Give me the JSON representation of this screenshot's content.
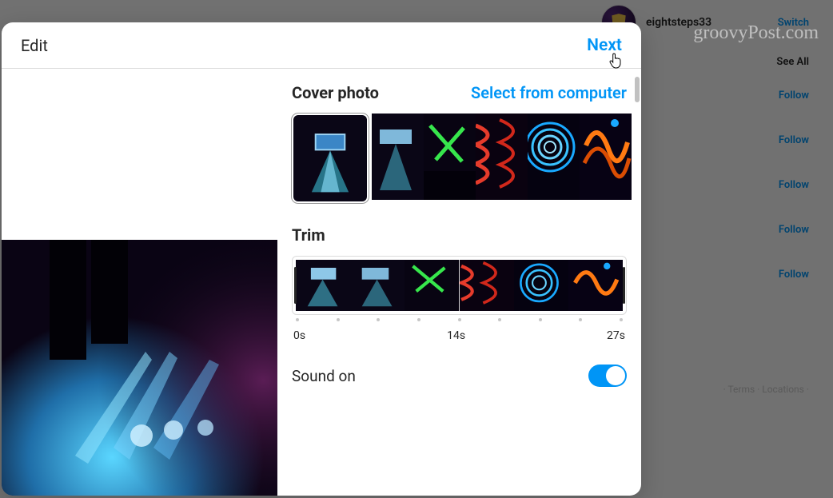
{
  "watermark": "groovyPost.com",
  "bg": {
    "username": "eightsteps33",
    "switch": "Switch",
    "see_all": "See All",
    "follow": "Follow",
    "footer": "· Terms · Locations ·"
  },
  "modal": {
    "header": {
      "left": "Edit",
      "right": "Next"
    },
    "cover": {
      "title": "Cover photo",
      "select": "Select from computer"
    },
    "trim": {
      "title": "Trim",
      "ticks": {
        "start": "0s",
        "mid": "14s",
        "end": "27s"
      }
    },
    "sound": {
      "label": "Sound on",
      "on": true
    }
  }
}
